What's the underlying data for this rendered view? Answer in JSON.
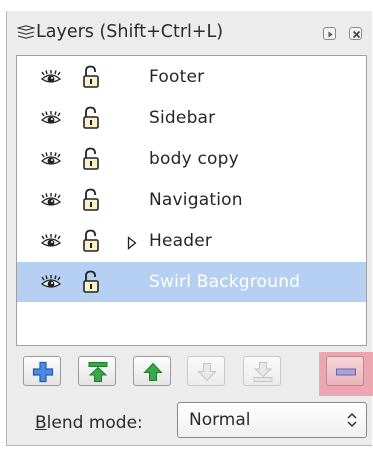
{
  "panel": {
    "title": "Layers (Shift+Ctrl+L)",
    "title_icon": "layers-icon",
    "titlebar_buttons": [
      "dock-arrow-icon",
      "close-x-icon"
    ]
  },
  "layers": [
    {
      "name": "Footer",
      "visible": true,
      "locked": false,
      "has_children": false,
      "selected": false
    },
    {
      "name": "Sidebar",
      "visible": true,
      "locked": false,
      "has_children": false,
      "selected": false
    },
    {
      "name": "body copy",
      "visible": true,
      "locked": false,
      "has_children": false,
      "selected": false
    },
    {
      "name": "Navigation",
      "visible": true,
      "locked": false,
      "has_children": false,
      "selected": false
    },
    {
      "name": "Header",
      "visible": true,
      "locked": false,
      "has_children": true,
      "selected": false
    },
    {
      "name": "Swirl Background",
      "visible": true,
      "locked": false,
      "has_children": false,
      "selected": true
    }
  ],
  "toolbar": {
    "buttons": [
      {
        "name": "add-layer-button",
        "icon": "plus-icon",
        "enabled": true
      },
      {
        "name": "raise-to-top-button",
        "icon": "raise-to-top-icon",
        "enabled": true
      },
      {
        "name": "raise-layer-button",
        "icon": "arrow-up-icon",
        "enabled": true
      },
      {
        "name": "lower-layer-button",
        "icon": "arrow-down-icon",
        "enabled": false
      },
      {
        "name": "lower-to-bottom-button",
        "icon": "lower-to-bottom-icon",
        "enabled": false
      },
      {
        "name": "remove-layer-button",
        "icon": "minus-icon",
        "enabled": true,
        "highlighted": true
      }
    ]
  },
  "blend": {
    "label_mnemonic": "B",
    "label_rest": "lend mode:",
    "value": "Normal"
  },
  "colors": {
    "panel_bg": "#ececec",
    "selection": "#b5d0f3",
    "add_green": "#2e9e3a",
    "add_blue": "#3b7dd8",
    "highlight": "#ec9aa6"
  }
}
